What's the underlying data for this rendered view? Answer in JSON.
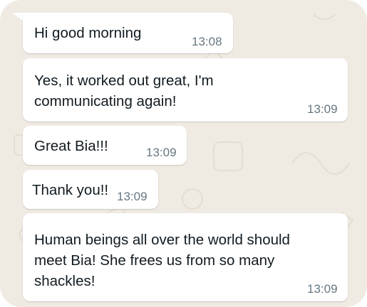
{
  "colors": {
    "background": "#efeae2",
    "bubble": "#ffffff",
    "text": "#111b21",
    "timestamp": "#667781"
  },
  "messages": [
    {
      "lines": [
        "Hi good morning"
      ],
      "time": "13:08"
    },
    {
      "lines": [
        "Yes, it worked out great, I'm",
        "communicating again!"
      ],
      "time": "13:09"
    },
    {
      "lines": [
        "Great Bia!!!"
      ],
      "time": "13:09"
    },
    {
      "lines": [
        "Thank you!!"
      ],
      "time": "13:09"
    },
    {
      "lines": [
        "Human beings all over the world should",
        "meet Bia! She frees us from so many",
        "shackles!"
      ],
      "time": "13:09"
    }
  ]
}
